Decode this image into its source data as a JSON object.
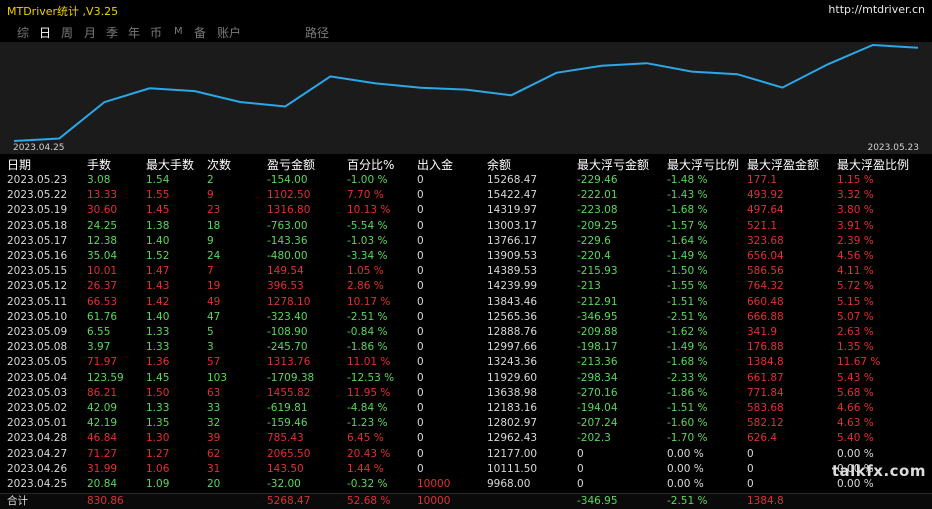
{
  "app": {
    "title": "MTDriver统计 ,V3.25",
    "link": "http://mtdriver.cn"
  },
  "tabs": [
    "综",
    "日",
    "周",
    "月",
    "季",
    "年",
    "币",
    "M",
    "备",
    "账户",
    "路径"
  ],
  "active_tab": 1,
  "chart": {
    "start_label": "2023.04.25",
    "end_label": "2023.05.23",
    "line_color": "#2aa8e8",
    "balances": [
      9968.0,
      10111.5,
      12177.0,
      12962.43,
      12802.97,
      12183.16,
      11929.6,
      13638.98,
      13243.36,
      12997.66,
      12888.76,
      12565.36,
      13843.46,
      14239.99,
      14389.53,
      13909.53,
      13766.17,
      13003.17,
      14319.97,
      15422.47,
      15268.47
    ]
  },
  "headers": [
    "日期",
    "手数",
    "最大手数",
    "次数",
    "盈亏金额",
    "百分比%",
    "出入金",
    "余额",
    "最大浮亏金额",
    "最大浮亏比例",
    "最大浮盈金额",
    "最大浮盈比例"
  ],
  "rows": [
    {
      "cells": [
        "2023.05.23",
        "3.08",
        "1.54",
        "2",
        "-154.00",
        "-1.00 %",
        "0",
        "15268.47",
        "-229.46",
        "-1.48 %",
        "177.1",
        "1.15 %"
      ],
      "c": "g"
    },
    {
      "cells": [
        "2023.05.22",
        "13.33",
        "1.55",
        "9",
        "1102.50",
        "7.70 %",
        "0",
        "15422.47",
        "-222.01",
        "-1.43 %",
        "493.92",
        "3.32 %"
      ],
      "c": "r"
    },
    {
      "cells": [
        "2023.05.19",
        "30.60",
        "1.45",
        "23",
        "1316.80",
        "10.13 %",
        "0",
        "14319.97",
        "-223.08",
        "-1.68 %",
        "497.64",
        "3.80 %"
      ],
      "c": "r"
    },
    {
      "cells": [
        "2023.05.18",
        "24.25",
        "1.38",
        "18",
        "-763.00",
        "-5.54 %",
        "0",
        "13003.17",
        "-209.25",
        "-1.57 %",
        "521.1",
        "3.91 %"
      ],
      "c": "g"
    },
    {
      "cells": [
        "2023.05.17",
        "12.38",
        "1.40",
        "9",
        "-143.36",
        "-1.03 %",
        "0",
        "13766.17",
        "-229.6",
        "-1.64 %",
        "323.68",
        "2.39 %"
      ],
      "c": "g"
    },
    {
      "cells": [
        "2023.05.16",
        "35.04",
        "1.52",
        "24",
        "-480.00",
        "-3.34 %",
        "0",
        "13909.53",
        "-220.4",
        "-1.49 %",
        "656.04",
        "4.56 %"
      ],
      "c": "g"
    },
    {
      "cells": [
        "2023.05.15",
        "10.01",
        "1.47",
        "7",
        "149.54",
        "1.05 %",
        "0",
        "14389.53",
        "-215.93",
        "-1.50 %",
        "586.56",
        "4.11 %"
      ],
      "c": "r"
    },
    {
      "cells": [
        "2023.05.12",
        "26.37",
        "1.43",
        "19",
        "396.53",
        "2.86 %",
        "0",
        "14239.99",
        "-213",
        "-1.55 %",
        "764.32",
        "5.72 %"
      ],
      "c": "r"
    },
    {
      "cells": [
        "2023.05.11",
        "66.53",
        "1.42",
        "49",
        "1278.10",
        "10.17 %",
        "0",
        "13843.46",
        "-212.91",
        "-1.51 %",
        "660.48",
        "5.15 %"
      ],
      "c": "r"
    },
    {
      "cells": [
        "2023.05.10",
        "61.76",
        "1.40",
        "47",
        "-323.40",
        "-2.51 %",
        "0",
        "12565.36",
        "-346.95",
        "-2.51 %",
        "666.88",
        "5.07 %"
      ],
      "c": "g"
    },
    {
      "cells": [
        "2023.05.09",
        "6.55",
        "1.33",
        "5",
        "-108.90",
        "-0.84 %",
        "0",
        "12888.76",
        "-209.88",
        "-1.62 %",
        "341.9",
        "2.63 %"
      ],
      "c": "g"
    },
    {
      "cells": [
        "2023.05.08",
        "3.97",
        "1.33",
        "3",
        "-245.70",
        "-1.86 %",
        "0",
        "12997.66",
        "-198.17",
        "-1.49 %",
        "176.88",
        "1.35 %"
      ],
      "c": "g"
    },
    {
      "cells": [
        "2023.05.05",
        "71.97",
        "1.36",
        "57",
        "1313.76",
        "11.01 %",
        "0",
        "13243.36",
        "-213.36",
        "-1.68 %",
        "1384.8",
        "11.67 %"
      ],
      "c": "r"
    },
    {
      "cells": [
        "2023.05.04",
        "123.59",
        "1.45",
        "103",
        "-1709.38",
        "-12.53 %",
        "0",
        "11929.60",
        "-298.34",
        "-2.33 %",
        "661.87",
        "5.43 %"
      ],
      "c": "g"
    },
    {
      "cells": [
        "2023.05.03",
        "86.21",
        "1.50",
        "63",
        "1455.82",
        "11.95 %",
        "0",
        "13638.98",
        "-270.16",
        "-1.86 %",
        "771.84",
        "5.68 %"
      ],
      "c": "r"
    },
    {
      "cells": [
        "2023.05.02",
        "42.09",
        "1.33",
        "33",
        "-619.81",
        "-4.84 %",
        "0",
        "12183.16",
        "-194.04",
        "-1.51 %",
        "583.68",
        "4.66 %"
      ],
      "c": "g"
    },
    {
      "cells": [
        "2023.05.01",
        "42.19",
        "1.35",
        "32",
        "-159.46",
        "-1.23 %",
        "0",
        "12802.97",
        "-207.24",
        "-1.60 %",
        "582.12",
        "4.63 %"
      ],
      "c": "g"
    },
    {
      "cells": [
        "2023.04.28",
        "46.84",
        "1.30",
        "39",
        "785.43",
        "6.45 %",
        "0",
        "12962.43",
        "-202.3",
        "-1.70 %",
        "626.4",
        "5.40 %"
      ],
      "c": "r"
    },
    {
      "cells": [
        "2023.04.27",
        "71.27",
        "1.27",
        "62",
        "2065.50",
        "20.43 %",
        "0",
        "12177.00",
        "0",
        "0.00 %",
        "0",
        "0.00 %"
      ],
      "c": "r"
    },
    {
      "cells": [
        "2023.04.26",
        "31.99",
        "1.06",
        "31",
        "143.50",
        "1.44 %",
        "0",
        "10111.50",
        "0",
        "0.00 %",
        "0",
        "0.00 %"
      ],
      "c": "r"
    },
    {
      "cells": [
        "2023.04.25",
        "20.84",
        "1.09",
        "20",
        "-32.00",
        "-0.32 %",
        "10000",
        "9968.00",
        "0",
        "0.00 %",
        "0",
        "0.00 %"
      ],
      "c": "g"
    }
  ],
  "total": {
    "label": "合计",
    "lots": "830.86",
    "profit": "5268.47",
    "pct": "52.68 %",
    "deposit": "10000",
    "max_float_loss": "-346.95",
    "max_float_loss_pct": "-2.51 %",
    "max_float_profit": "1384.8"
  },
  "watermark": "talkfx.com"
}
